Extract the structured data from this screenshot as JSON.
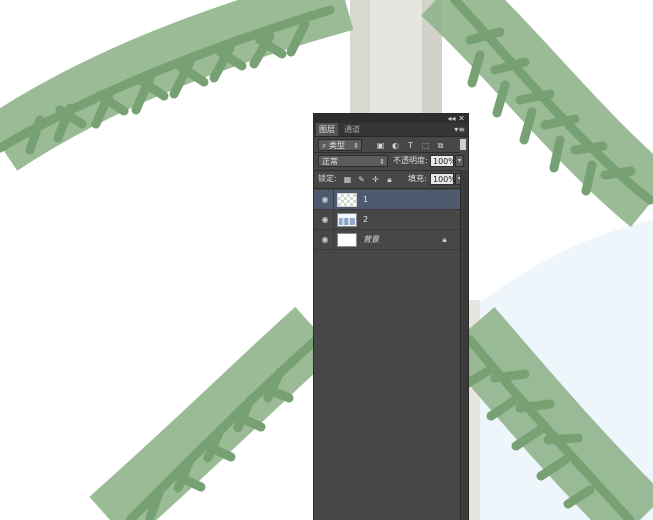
{
  "canvas": {
    "colors": {
      "branch_green": "#8fb48b",
      "trunk_light": "#e6e5df",
      "trunk_shade": "#d3d2ca",
      "sky_blue": "#eef5fb",
      "background": "#ffffff"
    }
  },
  "panel": {
    "window_controls": {
      "collapse_glyph": "◂◂",
      "close_glyph": "✕"
    },
    "tabs": [
      {
        "label": "图层",
        "active": true
      },
      {
        "label": "通道",
        "active": false
      }
    ],
    "menu_icon": "panel-menu-icon",
    "filter": {
      "kind_label": "类型",
      "icons": [
        "image-filter-icon",
        "adjustment-filter-icon",
        "type-filter-icon",
        "shape-filter-icon",
        "smart-object-filter-icon"
      ]
    },
    "blend": {
      "mode": "正常",
      "opacity_label": "不透明度:",
      "opacity_value": "100%"
    },
    "lock": {
      "label": "锁定:",
      "icons": [
        "lock-transparent-icon",
        "lock-paint-icon",
        "lock-move-icon",
        "lock-all-icon"
      ],
      "fill_label": "填充:",
      "fill_value": "100%"
    },
    "layers": [
      {
        "name": "1",
        "selected": true,
        "thumb": "checker",
        "locked": false,
        "italic": false
      },
      {
        "name": "2",
        "selected": false,
        "thumb": "trees",
        "locked": false,
        "italic": false
      },
      {
        "name": "背景",
        "selected": false,
        "thumb": "white",
        "locked": true,
        "italic": true
      }
    ]
  }
}
